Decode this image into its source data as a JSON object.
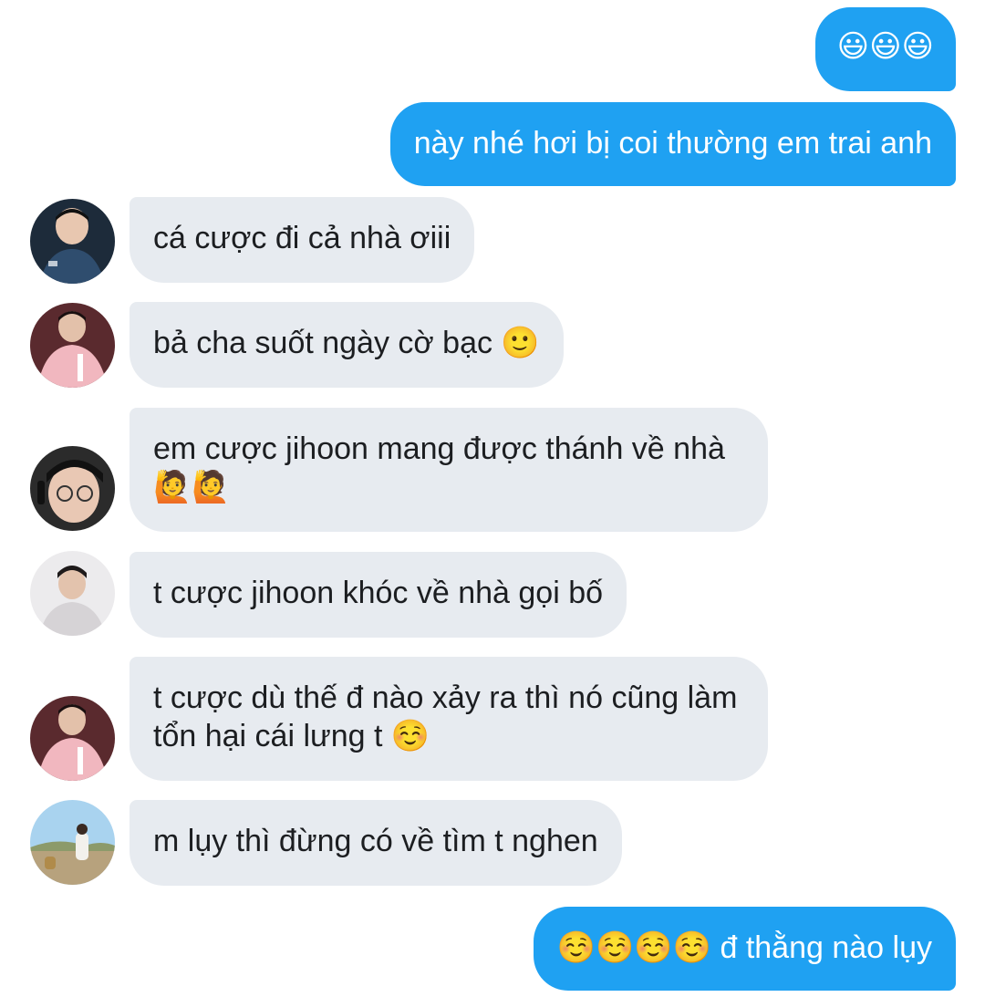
{
  "conversation": {
    "messages": [
      {
        "id": "m1",
        "direction": "sent",
        "text": "😃😃😃"
      },
      {
        "id": "m2",
        "direction": "sent",
        "text": "này nhé hơi bị coi thường em trai anh"
      },
      {
        "id": "m3",
        "direction": "received",
        "avatar": "avatar-1",
        "text": "cá cược đi cả nhà ơiii"
      },
      {
        "id": "m4",
        "direction": "received",
        "avatar": "avatar-2",
        "text": "bả cha suốt ngày cờ bạc 🙂"
      },
      {
        "id": "m5",
        "direction": "received",
        "avatar": "avatar-3",
        "text": "em cược jihoon mang được thánh về nhà 🙋🙋"
      },
      {
        "id": "m6",
        "direction": "received",
        "avatar": "avatar-4",
        "text": "t cược jihoon khóc về nhà gọi bố"
      },
      {
        "id": "m7",
        "direction": "received",
        "avatar": "avatar-2",
        "text": "t cược dù thế đ nào xảy ra thì nó cũng làm tổn hại cái lưng t ☺️"
      },
      {
        "id": "m8",
        "direction": "received",
        "avatar": "avatar-5",
        "text": "m lụy thì đừng có về tìm t nghen"
      },
      {
        "id": "m9",
        "direction": "sent",
        "text": "☺️☺️☺️☺️ đ thằng nào lụy"
      }
    ]
  },
  "colors": {
    "sent_bubble": "#1fa1f2",
    "received_bubble": "#e7ebf0",
    "sent_text": "#ffffff",
    "received_text": "#1c1e21"
  }
}
